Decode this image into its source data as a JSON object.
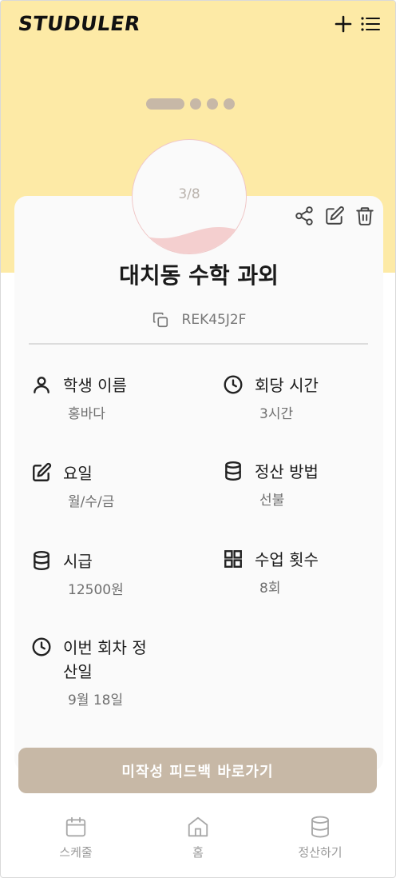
{
  "app": {
    "logo": "STUDULER"
  },
  "header": {
    "add_icon": "plus-icon",
    "list_icon": "list-icon"
  },
  "carousel": {
    "pages": 4,
    "active_index": 0
  },
  "class": {
    "progress_text": "3/8",
    "progress_fraction": 0.375,
    "title": "대치동 수학 과외",
    "code": "REK45J2F",
    "actions": [
      "share-icon",
      "edit-icon",
      "trash-icon"
    ]
  },
  "info": {
    "student_name": {
      "label": "학생 이름",
      "value": "홍바다"
    },
    "session_time": {
      "label": "회당 시간",
      "value": "3시간"
    },
    "days": {
      "label": "요일",
      "value": "월/수/금"
    },
    "payment_method": {
      "label": "정산 방법",
      "value": "선불"
    },
    "hourly_rate": {
      "label": "시급",
      "value": "12500원"
    },
    "session_count": {
      "label": "수업 횟수",
      "value": "8회"
    },
    "next_settlement": {
      "label_line1": "이번 회차 정",
      "label_line2": "산일",
      "value": "9월 18일"
    }
  },
  "cta": {
    "label": "미작성 피드백 바로가기"
  },
  "tabs": [
    {
      "label": "스케줄",
      "icon": "calendar-icon"
    },
    {
      "label": "홈",
      "icon": "home-icon"
    },
    {
      "label": "정산하기",
      "icon": "database-icon"
    }
  ],
  "colors": {
    "header_bg": "#fdeaa6",
    "accent": "#c7b8a6",
    "progress_fill": "#f4cfcf"
  }
}
